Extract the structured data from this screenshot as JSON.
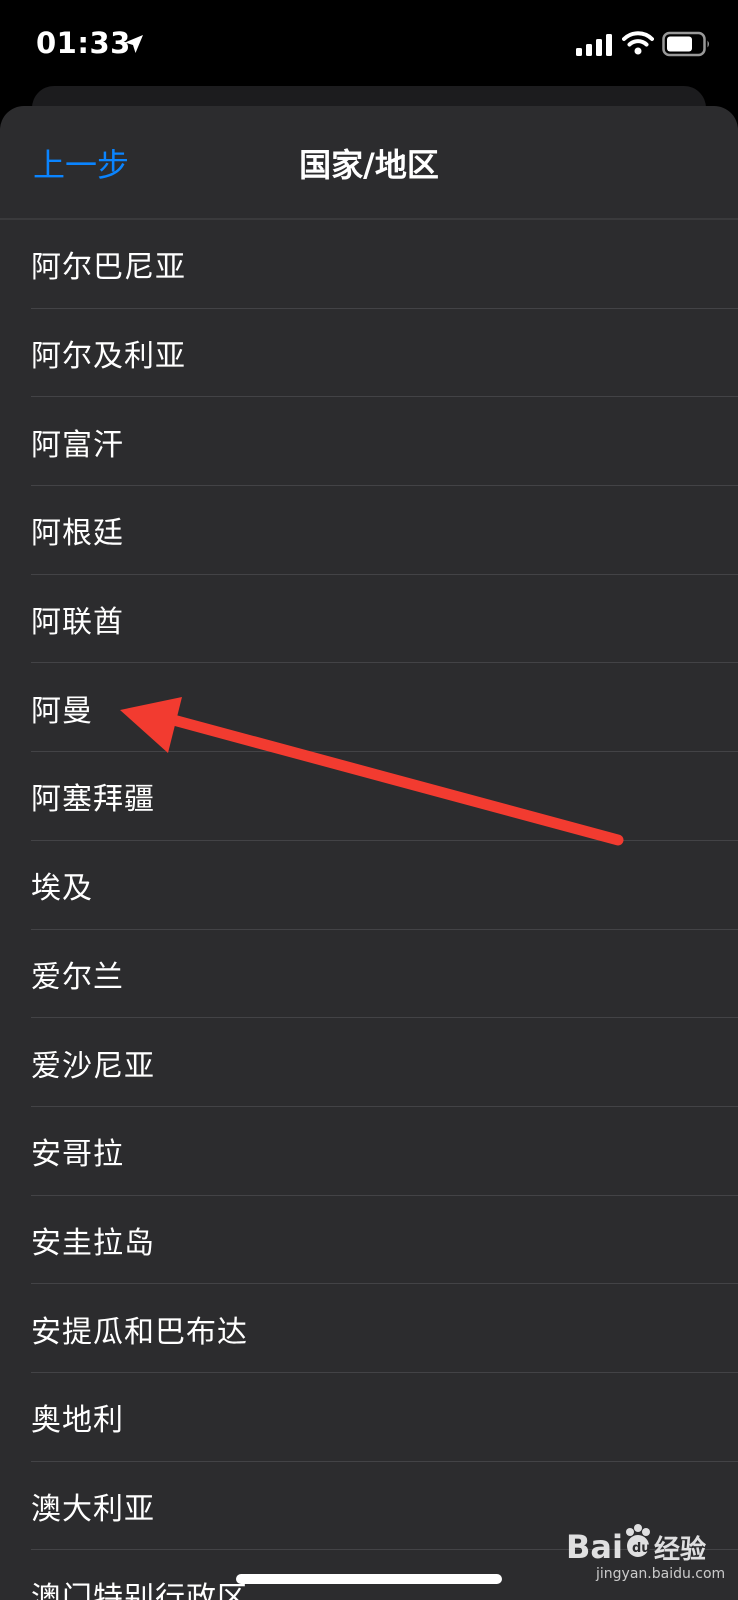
{
  "status_bar": {
    "time": "01:33",
    "icons": [
      "location-arrow-icon",
      "cellular-signal-icon",
      "wifi-icon",
      "battery-icon"
    ]
  },
  "nav": {
    "back_label": "上一步",
    "title": "国家/地区"
  },
  "countries": [
    "阿尔巴尼亚",
    "阿尔及利亚",
    "阿富汗",
    "阿根廷",
    "阿联酋",
    "阿曼",
    "阿塞拜疆",
    "埃及",
    "爱尔兰",
    "爱沙尼亚",
    "安哥拉",
    "安圭拉岛",
    "安提瓜和巴布达",
    "奥地利",
    "澳大利亚",
    "澳门特别行政区"
  ],
  "annotation": {
    "type": "red-arrow",
    "points_to": "阿曼",
    "color": "#f23b30"
  },
  "watermark": {
    "brand": "Baidu经验",
    "sub": "jingyan.baidu.com"
  },
  "colors": {
    "sheet_background": "#2c2c2e",
    "accent": "#0a84ff",
    "text": "#ffffff",
    "separator": "#434346"
  }
}
